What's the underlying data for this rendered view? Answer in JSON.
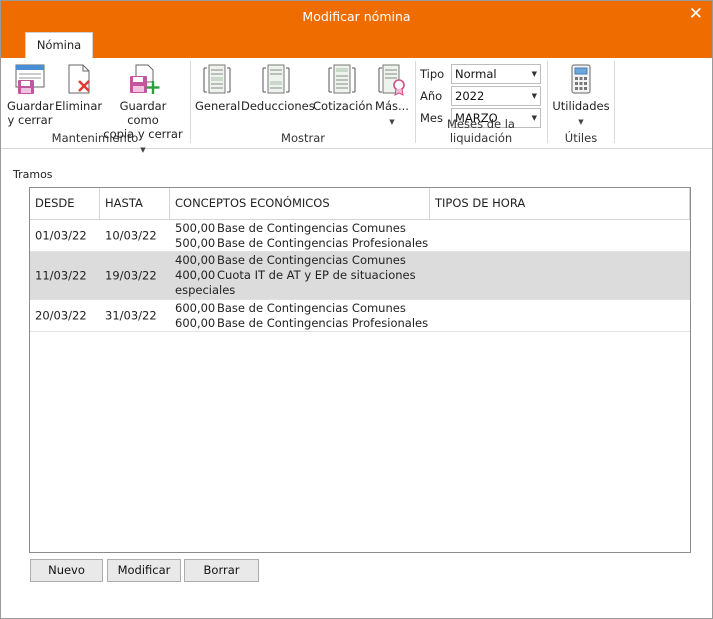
{
  "window": {
    "title": "Modificar nómina",
    "close_label": "✕"
  },
  "ribbon_tab": "Nómina",
  "groups": {
    "mantenimiento": {
      "label": "Mantenimiento",
      "guardar_line1": "Guardar",
      "guardar_line2": "y cerrar",
      "eliminar": "Eliminar",
      "copia_line1": "Guardar como",
      "copia_line2": "copia y cerrar"
    },
    "mostrar": {
      "label": "Mostrar",
      "general": "General",
      "deducciones": "Deducciones",
      "cotizacion": "Cotización",
      "mas": "Más..."
    },
    "meses": {
      "label": "Meses de la liquidación",
      "tipo_label": "Tipo",
      "tipo_value": "Normal",
      "anio_label": "Año",
      "anio_value": "2022",
      "mes_label": "Mes",
      "mes_value": "MARZO"
    },
    "utiles": {
      "label": "Útiles",
      "utilidades": "Utilidades"
    }
  },
  "tramos_label": "Tramos",
  "table": {
    "headers": [
      "DESDE",
      "HASTA",
      "CONCEPTOS ECONÓMICOS",
      "TIPOS DE HORA"
    ],
    "rows": [
      {
        "desde": "01/03/22",
        "hasta": "10/03/22",
        "c1_amt": "500,00",
        "c1_txt": "Base de Contingencias Comunes",
        "c2_amt": "500,00",
        "c2_txt": "Base de Contingencias Profesionales"
      },
      {
        "desde": "11/03/22",
        "hasta": "19/03/22",
        "c1_amt": "400,00",
        "c1_txt": "Base de Contingencias Comunes",
        "c2_amt": "400,00",
        "c2_txt": "Cuota IT de AT y EP de situaciones",
        "c2_cont": "especiales"
      },
      {
        "desde": "20/03/22",
        "hasta": "31/03/22",
        "c1_amt": "600,00",
        "c1_txt": "Base de Contingencias Comunes",
        "c2_amt": "600,00",
        "c2_txt": "Base de Contingencias Profesionales"
      }
    ]
  },
  "buttons": {
    "nuevo": "Nuevo",
    "modificar": "Modificar",
    "borrar": "Borrar"
  },
  "colors": {
    "accent": "#ef6c00",
    "selected_row": "#dcdcdc"
  }
}
